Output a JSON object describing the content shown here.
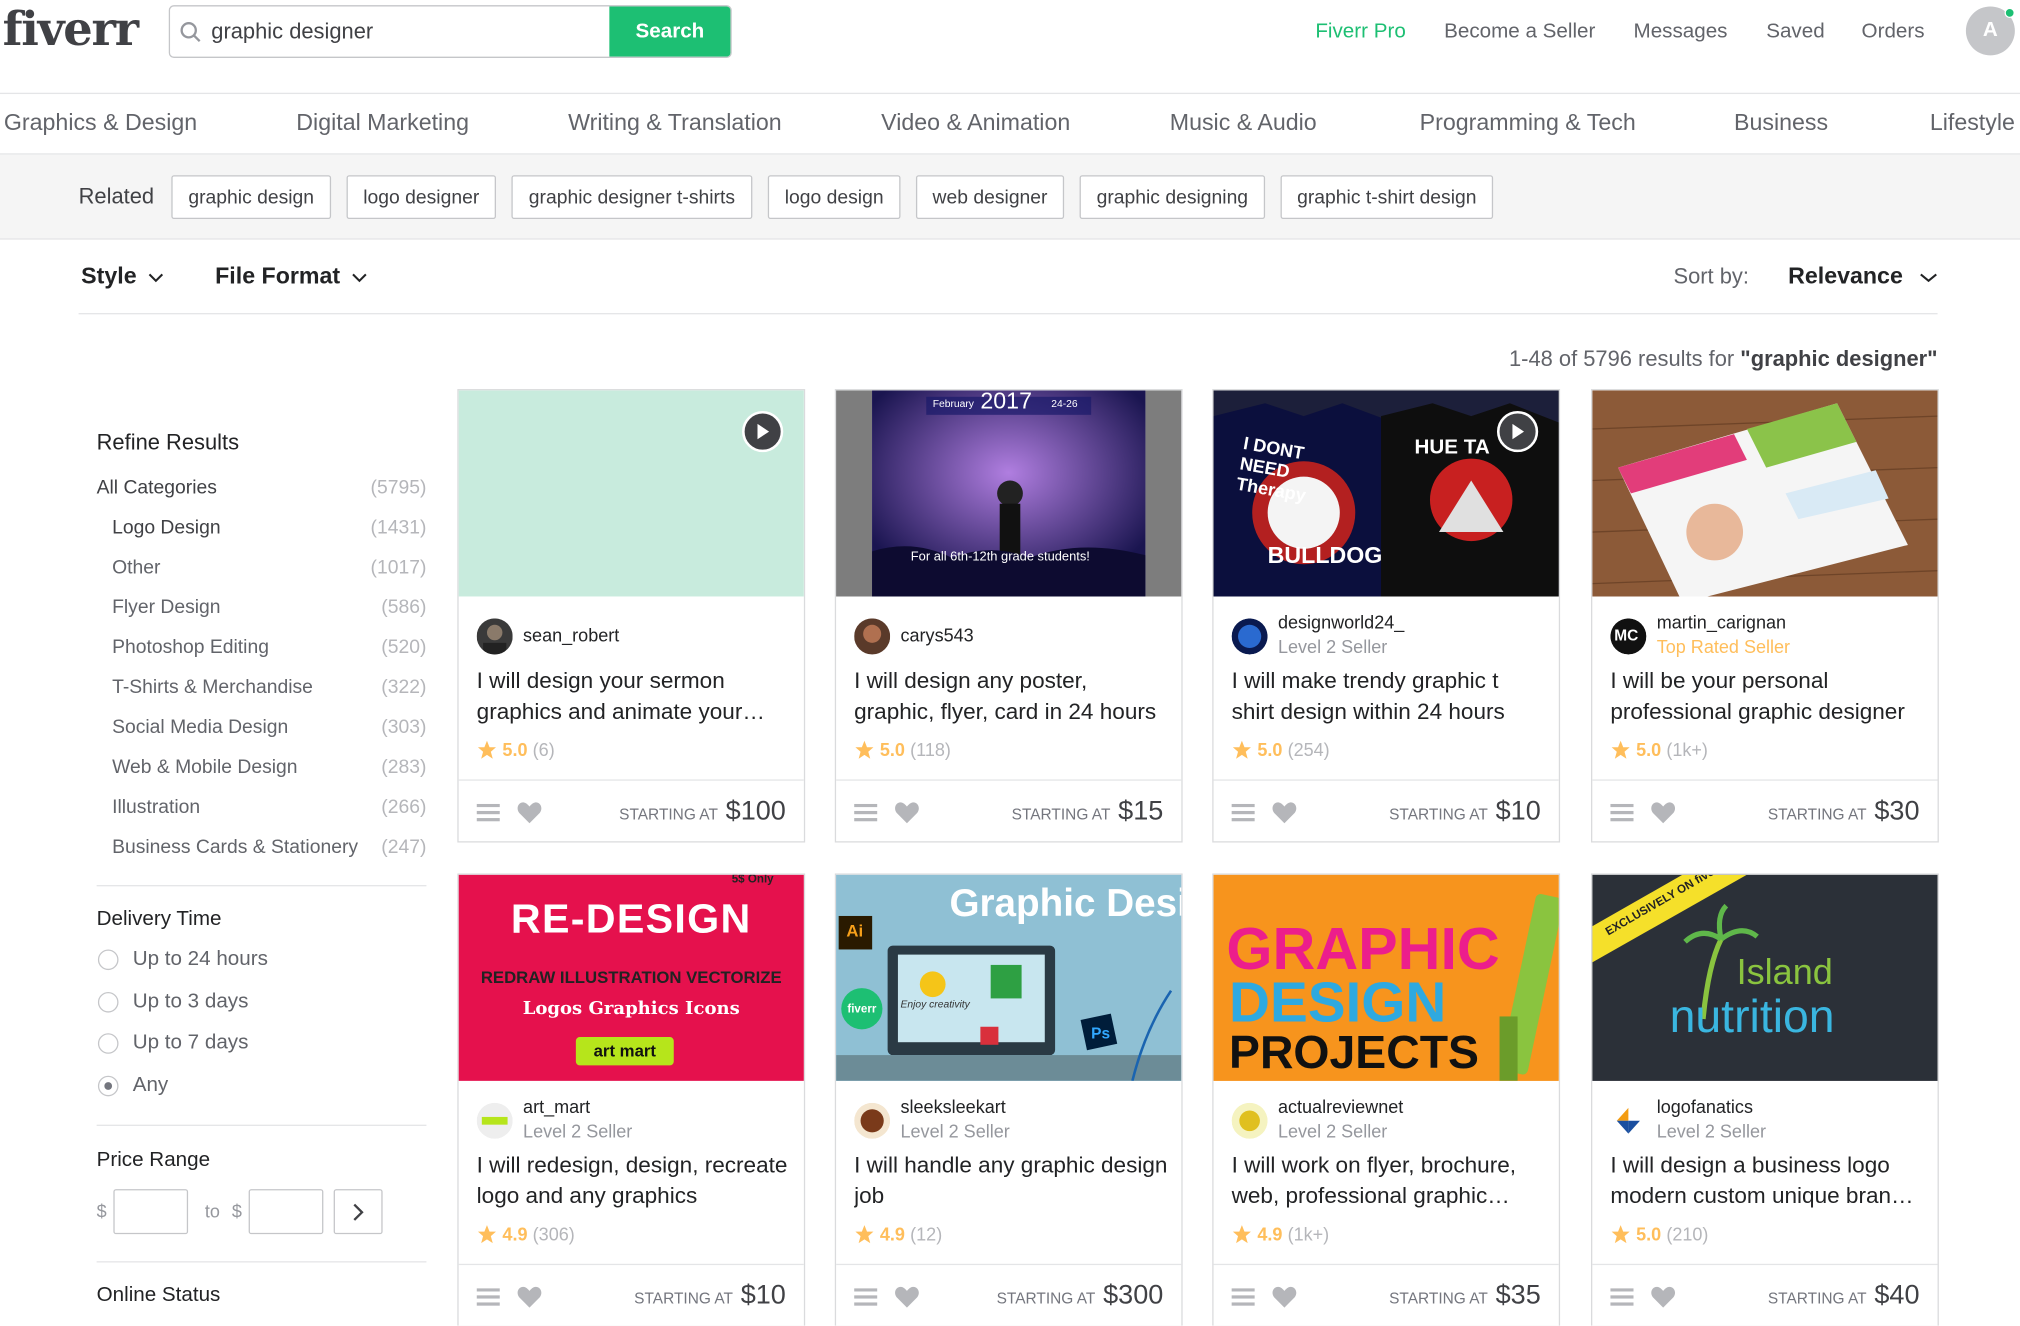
{
  "header": {
    "logo": "fiverr",
    "search_value": "graphic designer",
    "search_button": "Search",
    "nav": [
      "Fiverr Pro",
      "Become a Seller",
      "Messages",
      "Saved",
      "Orders"
    ],
    "avatar_initial": "A"
  },
  "categories": [
    "Graphics & Design",
    "Digital Marketing",
    "Writing & Translation",
    "Video & Animation",
    "Music & Audio",
    "Programming & Tech",
    "Business",
    "Lifestyle"
  ],
  "related": {
    "label": "Related",
    "tags": [
      "graphic design",
      "logo designer",
      "graphic designer t-shirts",
      "logo design",
      "web designer",
      "graphic designing",
      "graphic t-shirt design"
    ]
  },
  "filters": {
    "style": "Style",
    "file_format": "File Format",
    "sort_label": "Sort by:",
    "sort_value": "Relevance"
  },
  "results": {
    "prefix": "1-48 of 5796 results for",
    "query": "\"graphic designer\""
  },
  "sidebar": {
    "refine_title": "Refine Results",
    "categories": [
      {
        "label": "All Categories",
        "count": "(5795)"
      },
      {
        "label": "Logo Design",
        "count": "(1431)"
      },
      {
        "label": "Other",
        "count": "(1017)"
      },
      {
        "label": "Flyer Design",
        "count": "(586)"
      },
      {
        "label": "Photoshop Editing",
        "count": "(520)"
      },
      {
        "label": "T-Shirts & Merchandise",
        "count": "(322)"
      },
      {
        "label": "Social Media Design",
        "count": "(303)"
      },
      {
        "label": "Web & Mobile Design",
        "count": "(283)"
      },
      {
        "label": "Illustration",
        "count": "(266)"
      },
      {
        "label": "Business Cards & Stationery",
        "count": "(247)"
      }
    ],
    "delivery_title": "Delivery Time",
    "delivery_options": [
      "Up to 24 hours",
      "Up to 3 days",
      "Up to 7 days",
      "Any"
    ],
    "price_title": "Price Range",
    "price_currency": "$",
    "price_to": "to",
    "online_title": "Online Status"
  },
  "cards": [
    {
      "seller": "sean_robert",
      "level": "",
      "title": "I will design your sermon graphics and animate your intro",
      "rating": "5.0",
      "reviews": "(6)",
      "starting": "STARTING AT",
      "price": "$100",
      "video": true
    },
    {
      "seller": "carys543",
      "level": "",
      "title": "I will design any poster, graphic, flyer, card in 24 hours",
      "rating": "5.0",
      "reviews": "(118)",
      "starting": "STARTING AT",
      "price": "$15",
      "video": false,
      "img_text": {
        "month": "February",
        "year": "2017",
        "dates": "24-26",
        "caption": "For all 6th-12th grade students!"
      }
    },
    {
      "seller": "designworld24_",
      "level": "Level 2 Seller",
      "title": "I will make trendy graphic t shirt design within 24 hours",
      "rating": "5.0",
      "reviews": "(254)",
      "starting": "STARTING AT",
      "price": "$10",
      "video": true,
      "img_text": {
        "left": "I DONT NEED Therapy",
        "left2": "BULLDOG",
        "right": "HUE TA"
      }
    },
    {
      "seller": "martin_carignan",
      "level": "Top Rated Seller",
      "title": "I will be your personal professional graphic designer",
      "rating": "5.0",
      "reviews": "(1k+)",
      "starting": "STARTING AT",
      "price": "$30",
      "video": false,
      "img_text": {
        "avatar": "MC"
      }
    },
    {
      "seller": "art_mart",
      "level": "Level 2 Seller",
      "title": "I will redesign, design, recreate logo and any graphics",
      "rating": "4.9",
      "reviews": "(306)",
      "starting": "STARTING AT",
      "price": "$10",
      "video": false,
      "img_text": {
        "headline": "RE-DESIGN",
        "line1": "REDRAW  ILLUSTRATION  VECTORIZE",
        "line2": "Logos  Graphics  Icons",
        "brand": "art mart",
        "corner": "5$ Only"
      }
    },
    {
      "seller": "sleeksleekart",
      "level": "Level 2 Seller",
      "title": "I will handle any graphic design job",
      "rating": "4.9",
      "reviews": "(12)",
      "starting": "STARTING AT",
      "price": "$300",
      "video": false,
      "img_text": {
        "headline": "Graphic Desig",
        "ai": "Ai",
        "ps": "Ps",
        "fiverr": "fiverr",
        "enjoy": "Enjoy creativity"
      }
    },
    {
      "seller": "actualreviewnet",
      "level": "Level 2 Seller",
      "title": "I will work on flyer, brochure, web, professional graphic design",
      "rating": "4.9",
      "reviews": "(1k+)",
      "starting": "STARTING AT",
      "price": "$35",
      "video": false,
      "img_text": {
        "l1": "GRAPHIC",
        "l2": "DESIGN",
        "l3": "PROJECTS"
      }
    },
    {
      "seller": "logofanatics",
      "level": "Level 2 Seller",
      "title": "I will design a business logo modern custom unique brand identity",
      "rating": "5.0",
      "reviews": "(210)",
      "starting": "STARTING AT",
      "price": "$40",
      "video": false,
      "img_text": {
        "ribbon": "EXCLUSIVELY ON fiverr",
        "brand1": "Island",
        "brand2": "nutrition"
      }
    }
  ],
  "colors": {
    "brand_green": "#1dbf73",
    "star": "#ffbe5b",
    "text": "#404145",
    "muted": "#62646a"
  }
}
